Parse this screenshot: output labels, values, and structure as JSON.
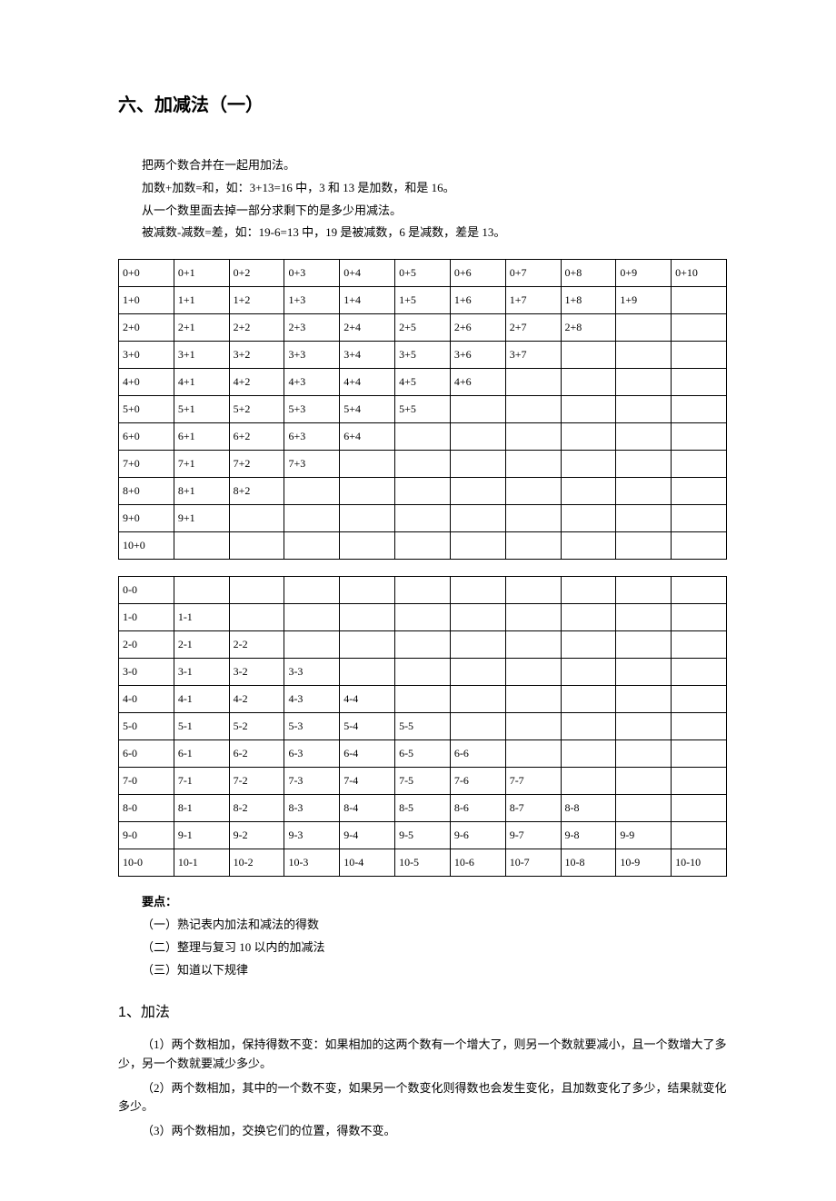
{
  "title": "六、加减法（一）",
  "intro": [
    "把两个数合并在一起用加法。",
    "加数+加数=和，如：3+13=16 中，3 和 13 是加数，和是 16。",
    "从一个数里面去掉一部分求剩下的是多少用减法。",
    "被减数-减数=差，如：19-6=13 中，19 是被减数，6 是减数，差是 13。"
  ],
  "addTable": [
    [
      "0+0",
      "0+1",
      "0+2",
      "0+3",
      "0+4",
      "0+5",
      "0+6",
      "0+7",
      "0+8",
      "0+9",
      "0+10"
    ],
    [
      "1+0",
      "1+1",
      "1+2",
      "1+3",
      "1+4",
      "1+5",
      "1+6",
      "1+7",
      "1+8",
      "1+9",
      ""
    ],
    [
      "2+0",
      "2+1",
      "2+2",
      "2+3",
      "2+4",
      "2+5",
      "2+6",
      "2+7",
      "2+8",
      "",
      ""
    ],
    [
      "3+0",
      "3+1",
      "3+2",
      "3+3",
      "3+4",
      "3+5",
      "3+6",
      "3+7",
      "",
      "",
      ""
    ],
    [
      "4+0",
      "4+1",
      "4+2",
      "4+3",
      "4+4",
      "4+5",
      "4+6",
      "",
      "",
      "",
      ""
    ],
    [
      "5+0",
      "5+1",
      "5+2",
      "5+3",
      "5+4",
      "5+5",
      "",
      "",
      "",
      "",
      ""
    ],
    [
      "6+0",
      "6+1",
      "6+2",
      "6+3",
      "6+4",
      "",
      "",
      "",
      "",
      "",
      ""
    ],
    [
      "7+0",
      "7+1",
      "7+2",
      "7+3",
      "",
      "",
      "",
      "",
      "",
      "",
      ""
    ],
    [
      "8+0",
      "8+1",
      "8+2",
      "",
      "",
      "",
      "",
      "",
      "",
      "",
      ""
    ],
    [
      "9+0",
      "9+1",
      "",
      "",
      "",
      "",
      "",
      "",
      "",
      "",
      ""
    ],
    [
      "10+0",
      "",
      "",
      "",
      "",
      "",
      "",
      "",
      "",
      "",
      ""
    ]
  ],
  "subTable": [
    [
      "0-0",
      "",
      "",
      "",
      "",
      "",
      "",
      "",
      "",
      "",
      ""
    ],
    [
      "1-0",
      "1-1",
      "",
      "",
      "",
      "",
      "",
      "",
      "",
      "",
      ""
    ],
    [
      "2-0",
      "2-1",
      "2-2",
      "",
      "",
      "",
      "",
      "",
      "",
      "",
      ""
    ],
    [
      "3-0",
      "3-1",
      "3-2",
      "3-3",
      "",
      "",
      "",
      "",
      "",
      "",
      ""
    ],
    [
      "4-0",
      "4-1",
      "4-2",
      "4-3",
      "4-4",
      "",
      "",
      "",
      "",
      "",
      ""
    ],
    [
      "5-0",
      "5-1",
      "5-2",
      "5-3",
      "5-4",
      "5-5",
      "",
      "",
      "",
      "",
      ""
    ],
    [
      "6-0",
      "6-1",
      "6-2",
      "6-3",
      "6-4",
      "6-5",
      "6-6",
      "",
      "",
      "",
      ""
    ],
    [
      "7-0",
      "7-1",
      "7-2",
      "7-3",
      "7-4",
      "7-5",
      "7-6",
      "7-7",
      "",
      "",
      ""
    ],
    [
      "8-0",
      "8-1",
      "8-2",
      "8-3",
      "8-4",
      "8-5",
      "8-6",
      "8-7",
      "8-8",
      "",
      ""
    ],
    [
      "9-0",
      "9-1",
      "9-2",
      "9-3",
      "9-4",
      "9-5",
      "9-6",
      "9-7",
      "9-8",
      "9-9",
      ""
    ],
    [
      "10-0",
      "10-1",
      "10-2",
      "10-3",
      "10-4",
      "10-5",
      "10-6",
      "10-7",
      "10-8",
      "10-9",
      "10-10"
    ]
  ],
  "points": {
    "title": "要点：",
    "items": [
      "（一）熟记表内加法和减法的得数",
      "（二）整理与复习 10 以内的加减法",
      "（三）知道以下规律"
    ]
  },
  "subheading": "1、加法",
  "rules": [
    "（1）两个数相加，保持得数不变：如果相加的这两个数有一个增大了，则另一个数就要减小，且一个数增大了多少，另一个数就要减少多少。",
    "（2）两个数相加，其中的一个数不变，如果另一个数变化则得数也会发生变化，且加数变化了多少，结果就变化多少。",
    "（3）两个数相加，交换它们的位置，得数不变。"
  ]
}
